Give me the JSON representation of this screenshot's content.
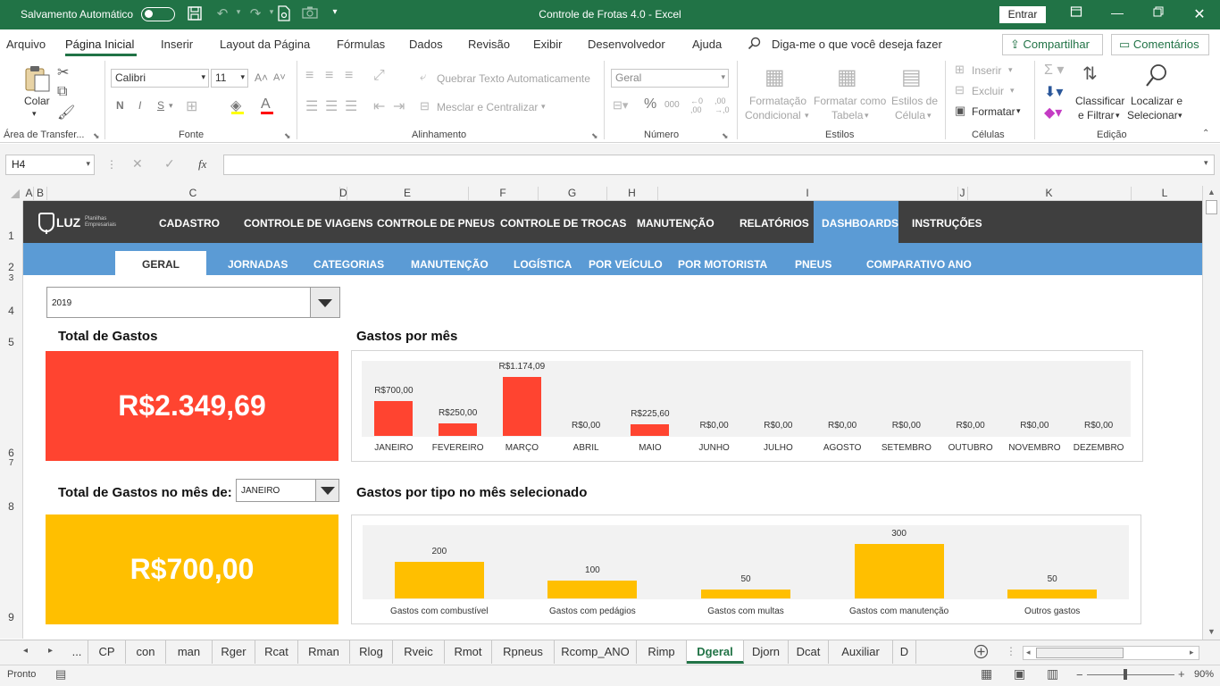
{
  "title_bar": {
    "autosave_label": "Salvamento Automático",
    "title": "Controle de Frotas 4.0  -  Excel",
    "signin_label": "Entrar"
  },
  "menu": {
    "tabs": [
      "Arquivo",
      "Página Inicial",
      "Inserir",
      "Layout da Página",
      "Fórmulas",
      "Dados",
      "Revisão",
      "Exibir",
      "Desenvolvedor",
      "Ajuda"
    ],
    "active_tab": "Página Inicial",
    "search_placeholder": "Diga-me o que você deseja fazer",
    "share_label": "Compartilhar",
    "comments_label": "Comentários"
  },
  "ribbon": {
    "clipboard": {
      "paste": "Colar",
      "group": "Área de Transfer..."
    },
    "font": {
      "name": "Calibri",
      "size": "11",
      "bold": "N",
      "italic": "I",
      "underline": "S",
      "group": "Fonte"
    },
    "alignment": {
      "wrap": "Quebrar Texto Automaticamente",
      "merge": "Mesclar e Centralizar",
      "group": "Alinhamento"
    },
    "number": {
      "format": "Geral",
      "group": "Número"
    },
    "styles": {
      "conditional_1": "Formatação",
      "conditional_2": "Condicional",
      "table_1": "Formatar como",
      "table_2": "Tabela",
      "cell_1": "Estilos de",
      "cell_2": "Célula",
      "group": "Estilos"
    },
    "cells": {
      "insert": "Inserir",
      "delete": "Excluir",
      "format": "Formatar",
      "group": "Células"
    },
    "editing": {
      "sort_1": "Classificar",
      "sort_2": "e Filtrar",
      "find_1": "Localizar e",
      "find_2": "Selecionar",
      "group": "Edição"
    }
  },
  "formula_bar": {
    "cell_ref": "H4",
    "fx": "fx",
    "content": ""
  },
  "columns": [
    "A",
    "B",
    "C",
    "D",
    "E",
    "F",
    "G",
    "H",
    "I",
    "J",
    "K",
    "L"
  ],
  "rows": [
    "1",
    "2",
    "3",
    "4",
    "5",
    "6",
    "7",
    "8",
    "9"
  ],
  "dashboard": {
    "logo_text": "LUZ",
    "logo_sub_1": "Planilhas",
    "logo_sub_2": "Empresariais",
    "nav_main": [
      "CADASTRO",
      "CONTROLE DE VIAGENS",
      "CONTROLE DE PNEUS",
      "CONTROLE DE TROCAS",
      "MANUTENÇÃO",
      "RELATÓRIOS",
      "DASHBOARDS",
      "INSTRUÇÕES"
    ],
    "nav_main_active": "DASHBOARDS",
    "nav_sub": [
      "GERAL",
      "JORNADAS",
      "CATEGORIAS",
      "MANUTENÇÃO",
      "LOGÍSTICA",
      "POR VEÍCULO",
      "POR MOTORISTA",
      "PNEUS",
      "COMPARATIVO ANO"
    ],
    "nav_sub_active": "GERAL",
    "year": "2019",
    "total_title": "Total de Gastos",
    "total_value": "R$2.349,69",
    "monthly_title": "Gastos por mês",
    "month_total_title": "Total de Gastos no mês de:",
    "month_selected": "JANEIRO",
    "month_total_value": "R$700,00",
    "type_title": "Gastos por tipo no mês selecionado",
    "colors": {
      "red": "#ff4430",
      "yellow": "#ffbf00",
      "nav_dark": "#3f3f3f",
      "nav_blue": "#5b9bd5"
    }
  },
  "chart_data": [
    {
      "type": "bar",
      "title": "Gastos por mês",
      "categories": [
        "JANEIRO",
        "FEVEREIRO",
        "MARÇO",
        "ABRIL",
        "MAIO",
        "JUNHO",
        "JULHO",
        "AGOSTO",
        "SETEMBRO",
        "OUTUBRO",
        "NOVEMBRO",
        "DEZEMBRO"
      ],
      "values": [
        700,
        250,
        1174.09,
        0,
        225.6,
        0,
        0,
        0,
        0,
        0,
        0,
        0
      ],
      "labels": [
        "R$700,00",
        "R$250,00",
        "R$1.174,09",
        "R$0,00",
        "R$225,60",
        "R$0,00",
        "R$0,00",
        "R$0,00",
        "R$0,00",
        "R$0,00",
        "R$0,00",
        "R$0,00"
      ],
      "ylim": [
        0,
        1174.09
      ],
      "grid": false,
      "color": "#ff4430"
    },
    {
      "type": "bar",
      "title": "Gastos por tipo no mês selecionado",
      "categories": [
        "Gastos com combustível",
        "Gastos com pedágios",
        "Gastos com multas",
        "Gastos com manutenção",
        "Outros gastos"
      ],
      "values": [
        200,
        100,
        50,
        300,
        50
      ],
      "labels": [
        "200",
        "100",
        "50",
        "300",
        "50"
      ],
      "ylim": [
        0,
        300
      ],
      "grid": false,
      "color": "#ffbf00"
    }
  ],
  "sheet_tabs": [
    "...",
    "CP",
    "con",
    "man",
    "Rger",
    "Rcat",
    "Rman",
    "Rlog",
    "Rveic",
    "Rmot",
    "Rpneus",
    "Rcomp_ANO",
    "Rimp",
    "Dgeral",
    "Djorn",
    "Dcat",
    "Auxiliar",
    "D"
  ],
  "active_sheet": "Dgeral",
  "status": {
    "ready": "Pronto",
    "zoom": "90%"
  }
}
